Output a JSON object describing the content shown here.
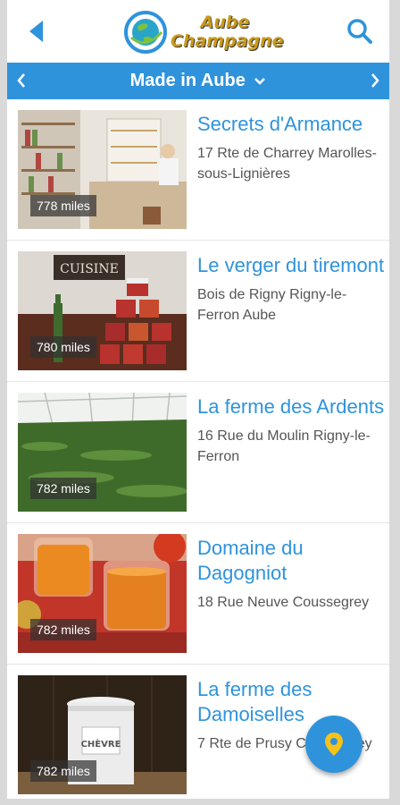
{
  "header": {
    "logo_line1": "Aube",
    "logo_line2": "Champagne",
    "back_icon": "back-arrow-icon",
    "search_icon": "search-icon"
  },
  "category": {
    "title": "Made in Aube",
    "prev_icon": "chevron-left-icon",
    "next_icon": "chevron-right-icon",
    "dropdown_icon": "chevron-down-icon"
  },
  "places": [
    {
      "name": "Secrets d'Armance",
      "address": "17 Rte de Charrey Marolles-sous-Lignières",
      "distance": "778 miles"
    },
    {
      "name": "Le verger du tiremont",
      "address": "Bois de Rigny Rigny-le-Ferron Aube",
      "distance": "780 miles",
      "sign": "CUISINE"
    },
    {
      "name": "La ferme des Ardents",
      "address": "16 Rue du Moulin Rigny-le-Ferron",
      "distance": "782 miles"
    },
    {
      "name": "Domaine du Dagogniot",
      "address": "18 Rue Neuve Coussegrey",
      "distance": "782 miles"
    },
    {
      "name": "La ferme des Damoiselles",
      "address": "7 Rte de Prusy Coussegrey",
      "distance": "782 miles",
      "label": "CHÈVRE"
    }
  ],
  "fab_icon": "map-pin-icon",
  "colors": {
    "accent": "#2f93db",
    "logo_gold": "#c89a1c"
  }
}
